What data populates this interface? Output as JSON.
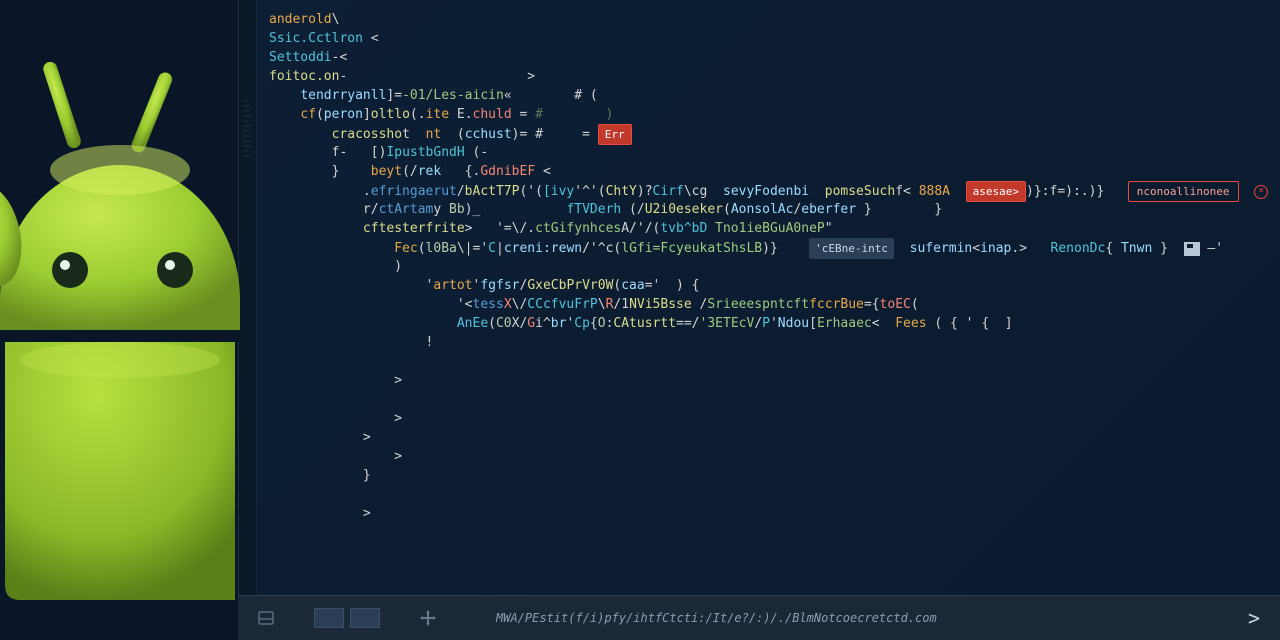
{
  "code": {
    "lines": [
      {
        "indent": 0,
        "tokens": [
          {
            "t": "anderold",
            "c": "kw"
          },
          {
            "t": "\\",
            "c": "op"
          }
        ]
      },
      {
        "indent": 0,
        "tokens": [
          {
            "t": "Ssic.Cctlron",
            "c": "type"
          },
          {
            "t": " <",
            "c": "op"
          }
        ]
      },
      {
        "indent": 0,
        "tokens": [
          {
            "t": "Settoddi",
            "c": "type"
          },
          {
            "t": "-<",
            "c": "op"
          }
        ]
      },
      {
        "indent": 0,
        "tokens": [
          {
            "t": "foitoc.on",
            "c": "fn"
          },
          {
            "t": "-                       >",
            "c": "op"
          }
        ]
      },
      {
        "indent": 1,
        "tokens": [
          {
            "t": "tendrryanll",
            "c": "param"
          },
          {
            "t": "]=",
            "c": "op"
          },
          {
            "t": "-01/Les-aicin",
            "c": "str"
          },
          {
            "t": "«        # (",
            "c": "op"
          }
        ]
      },
      {
        "indent": 1,
        "tokens": [
          {
            "t": "cf",
            "c": "kw"
          },
          {
            "t": "(",
            "c": "op"
          },
          {
            "t": "peron",
            "c": "param"
          },
          {
            "t": "]",
            "c": "op"
          },
          {
            "t": "oltlo",
            "c": "fn"
          },
          {
            "t": "(.",
            "c": "op"
          },
          {
            "t": "ite",
            "c": "kw"
          },
          {
            "t": " E.",
            "c": "op"
          },
          {
            "t": "chuld",
            "c": "err"
          },
          {
            "t": " = ",
            "c": "op"
          },
          {
            "t": "#        )",
            "c": "comment"
          }
        ]
      },
      {
        "indent": 2,
        "tokens": [
          {
            "t": "cracossho",
            "c": "fn"
          },
          {
            "t": "t  ",
            "c": "op"
          },
          {
            "t": "nt",
            "c": "kw"
          },
          {
            "t": "  (",
            "c": "op"
          },
          {
            "t": "cchust",
            "c": "param"
          },
          {
            "t": ")= #     =",
            "c": "op"
          }
        ],
        "badge_small": true
      },
      {
        "indent": 2,
        "tokens": [
          {
            "t": "f-   [)",
            "c": "op"
          },
          {
            "t": "IpustbGndH",
            "c": "type"
          },
          {
            "t": " (-",
            "c": "op"
          }
        ]
      },
      {
        "indent": 2,
        "tokens": [
          {
            "t": "}    ",
            "c": "op"
          },
          {
            "t": "beyt",
            "c": "kw"
          },
          {
            "t": "(/",
            "c": "op"
          },
          {
            "t": "rek",
            "c": "param"
          },
          {
            "t": "   {.",
            "c": "op"
          },
          {
            "t": "GdnibEF",
            "c": "err"
          },
          {
            "t": " <",
            "c": "op"
          }
        ]
      },
      {
        "indent": 3,
        "tokens": [
          {
            "t": ".",
            "c": "op"
          },
          {
            "t": "efringaerut",
            "c": "tag"
          },
          {
            "t": "/",
            "c": "op"
          },
          {
            "t": "bActT7P",
            "c": "fn"
          },
          {
            "t": "('(",
            "c": "op"
          },
          {
            "t": "[ivy",
            "c": "type"
          },
          {
            "t": "'^'(",
            "c": "op"
          },
          {
            "t": "ChtY",
            "c": "fn"
          },
          {
            "t": ")?",
            "c": "op"
          },
          {
            "t": "Cirf",
            "c": "type"
          },
          {
            "t": "\\cg",
            "c": "op"
          },
          {
            "t": "  ",
            "c": ""
          },
          {
            "t": "sevyFodenbi",
            "c": "param"
          },
          {
            "t": "  ",
            "c": ""
          },
          {
            "t": "pomseSuch",
            "c": "fn"
          },
          {
            "t": "f<",
            "c": "op"
          }
        ],
        "warn1": "asesae>",
        "warn_tail": ")}:f=):.)}",
        "warn2": "nconoallinonee",
        "circlex": true
      },
      {
        "indent": 3,
        "tokens": [
          {
            "t": "r/",
            "c": "op"
          },
          {
            "t": "ctArtam",
            "c": "tag"
          },
          {
            "t": "y ",
            "c": "op"
          },
          {
            "t": "Bb",
            "c": "num"
          },
          {
            "t": ")_           ",
            "c": "op"
          },
          {
            "t": "fTVDerh",
            "c": "type"
          },
          {
            "t": " (/",
            "c": "op"
          },
          {
            "t": "U2i0eseker",
            "c": "fn"
          },
          {
            "t": "(",
            "c": "op"
          },
          {
            "t": "AonsolAc",
            "c": "param"
          },
          {
            "t": "/",
            "c": "op"
          },
          {
            "t": "eberfer",
            "c": "param"
          },
          {
            "t": " }        }",
            "c": "op"
          }
        ]
      },
      {
        "indent": 3,
        "tokens": [
          {
            "t": "cftesterfrite",
            "c": "fn"
          },
          {
            "t": ">   '=\\/.",
            "c": "op"
          },
          {
            "t": "ctGifynhces",
            "c": "str"
          },
          {
            "t": "A/'/(",
            "c": "op"
          },
          {
            "t": "tvb^bD",
            "c": "type"
          },
          {
            "t": " ",
            "c": ""
          },
          {
            "t": "Tno1ieBGuA0neP",
            "c": "str"
          },
          {
            "t": "\"",
            "c": "op"
          }
        ]
      },
      {
        "indent": 4,
        "tokens": [
          {
            "t": "Fec",
            "c": "kw"
          },
          {
            "t": "(",
            "c": "op"
          },
          {
            "t": "l0Ba",
            "c": "num"
          },
          {
            "t": "\\|='",
            "c": "op"
          },
          {
            "t": "C",
            "c": "type"
          },
          {
            "t": "|",
            "c": "op"
          },
          {
            "t": "creni:rewn",
            "c": "param"
          },
          {
            "t": "/'^c(",
            "c": "op"
          },
          {
            "t": "lGfi=FcyeukatShsLB",
            "c": "str"
          },
          {
            "t": ")}   ",
            "c": "op"
          }
        ],
        "hint": "'cEBne-intc",
        "tokens2": [
          {
            "t": "  ",
            "c": ""
          },
          {
            "t": "sufermin",
            "c": "param"
          },
          {
            "t": "<",
            "c": "op"
          },
          {
            "t": "inap.",
            "c": "attr"
          },
          {
            "t": ">   ",
            "c": "op"
          },
          {
            "t": "RenonDc",
            "c": "type"
          },
          {
            "t": "{ ",
            "c": "op"
          },
          {
            "t": "Tnwn",
            "c": "param"
          },
          {
            "t": " }",
            "c": "op"
          }
        ],
        "save": true
      },
      {
        "indent": 4,
        "tokens": [
          {
            "t": ")",
            "c": "op"
          }
        ]
      },
      {
        "indent": 5,
        "tokens": [
          {
            "t": "'",
            "c": "op"
          },
          {
            "t": "artot",
            "c": "kw"
          },
          {
            "t": "'",
            "c": "op"
          },
          {
            "t": "fgfsr",
            "c": "param"
          },
          {
            "t": "/",
            "c": "op"
          },
          {
            "t": "GxeCbPrVr0W",
            "c": "fn"
          },
          {
            "t": "(",
            "c": "op"
          },
          {
            "t": "caa",
            "c": "param"
          },
          {
            "t": "='  ) {",
            "c": "op"
          }
        ]
      },
      {
        "indent": 6,
        "tokens": [
          {
            "t": "'<",
            "c": "op"
          },
          {
            "t": "tess",
            "c": "tag"
          },
          {
            "t": "X",
            "c": "err"
          },
          {
            "t": "\\/",
            "c": "op"
          },
          {
            "t": "CCcfvuFrP",
            "c": "type"
          },
          {
            "t": "\\",
            "c": "op"
          },
          {
            "t": "R",
            "c": "err"
          },
          {
            "t": "/1",
            "c": "op"
          },
          {
            "t": "NVi5Bsse",
            "c": "fn"
          },
          {
            "t": " /",
            "c": "op"
          },
          {
            "t": "Srieeespntcft",
            "c": "str"
          },
          {
            "t": "fccrBue",
            "c": "kw"
          },
          {
            "t": "={",
            "c": "op"
          },
          {
            "t": "toEC",
            "c": "err"
          },
          {
            "t": "(",
            "c": "op"
          }
        ]
      },
      {
        "indent": 6,
        "tokens": [
          {
            "t": "AnEe",
            "c": "type"
          },
          {
            "t": "(",
            "c": "op"
          },
          {
            "t": "C0",
            "c": "num"
          },
          {
            "t": "X/",
            "c": "op"
          },
          {
            "t": "G",
            "c": "err"
          },
          {
            "t": "i^",
            "c": "op"
          },
          {
            "t": "br",
            "c": "param"
          },
          {
            "t": "'",
            "c": "op"
          },
          {
            "t": "Cp",
            "c": "type"
          },
          {
            "t": "{",
            "c": "op"
          },
          {
            "t": "O",
            "c": "num"
          },
          {
            "t": ":",
            "c": "op"
          },
          {
            "t": "CAtusrtt",
            "c": "fn"
          },
          {
            "t": "==/",
            "c": "op"
          },
          {
            "t": "'3ETEcV",
            "c": "str"
          },
          {
            "t": "/",
            "c": "op"
          },
          {
            "t": "P",
            "c": "type"
          },
          {
            "t": "'",
            "c": "op"
          },
          {
            "t": "Ndou",
            "c": "param"
          },
          {
            "t": "[",
            "c": "op"
          },
          {
            "t": "Erhaaec",
            "c": "str"
          },
          {
            "t": "<  ",
            "c": "op"
          },
          {
            "t": "Fees",
            "c": "kw"
          },
          {
            "t": " ( { ' {  ]",
            "c": "op"
          }
        ]
      },
      {
        "indent": 5,
        "tokens": [
          {
            "t": "!",
            "c": "op"
          }
        ]
      },
      {
        "indent": 5,
        "tokens": [
          {
            "t": "",
            "c": ""
          }
        ]
      },
      {
        "indent": 4,
        "tokens": [
          {
            "t": ">",
            "c": "op"
          }
        ]
      },
      {
        "indent": 4,
        "tokens": [
          {
            "t": "",
            "c": ""
          }
        ]
      },
      {
        "indent": 4,
        "tokens": [
          {
            "t": ">",
            "c": "op"
          }
        ]
      },
      {
        "indent": 3,
        "tokens": [
          {
            "t": ">",
            "c": "op"
          }
        ]
      },
      {
        "indent": 4,
        "tokens": [
          {
            "t": ">",
            "c": "op"
          }
        ]
      },
      {
        "indent": 3,
        "tokens": [
          {
            "t": "}",
            "c": "op"
          }
        ]
      },
      {
        "indent": 3,
        "tokens": [
          {
            "t": "",
            "c": ""
          }
        ]
      },
      {
        "indent": 3,
        "tokens": [
          {
            "t": ">",
            "c": "op"
          }
        ]
      }
    ]
  },
  "statusbar": {
    "path": "MWA/PEstit(f/i)pfy/ihtfCtcti:/It/e?/:)/./BlmNotcoecretctd.com",
    "arrow": ">"
  }
}
